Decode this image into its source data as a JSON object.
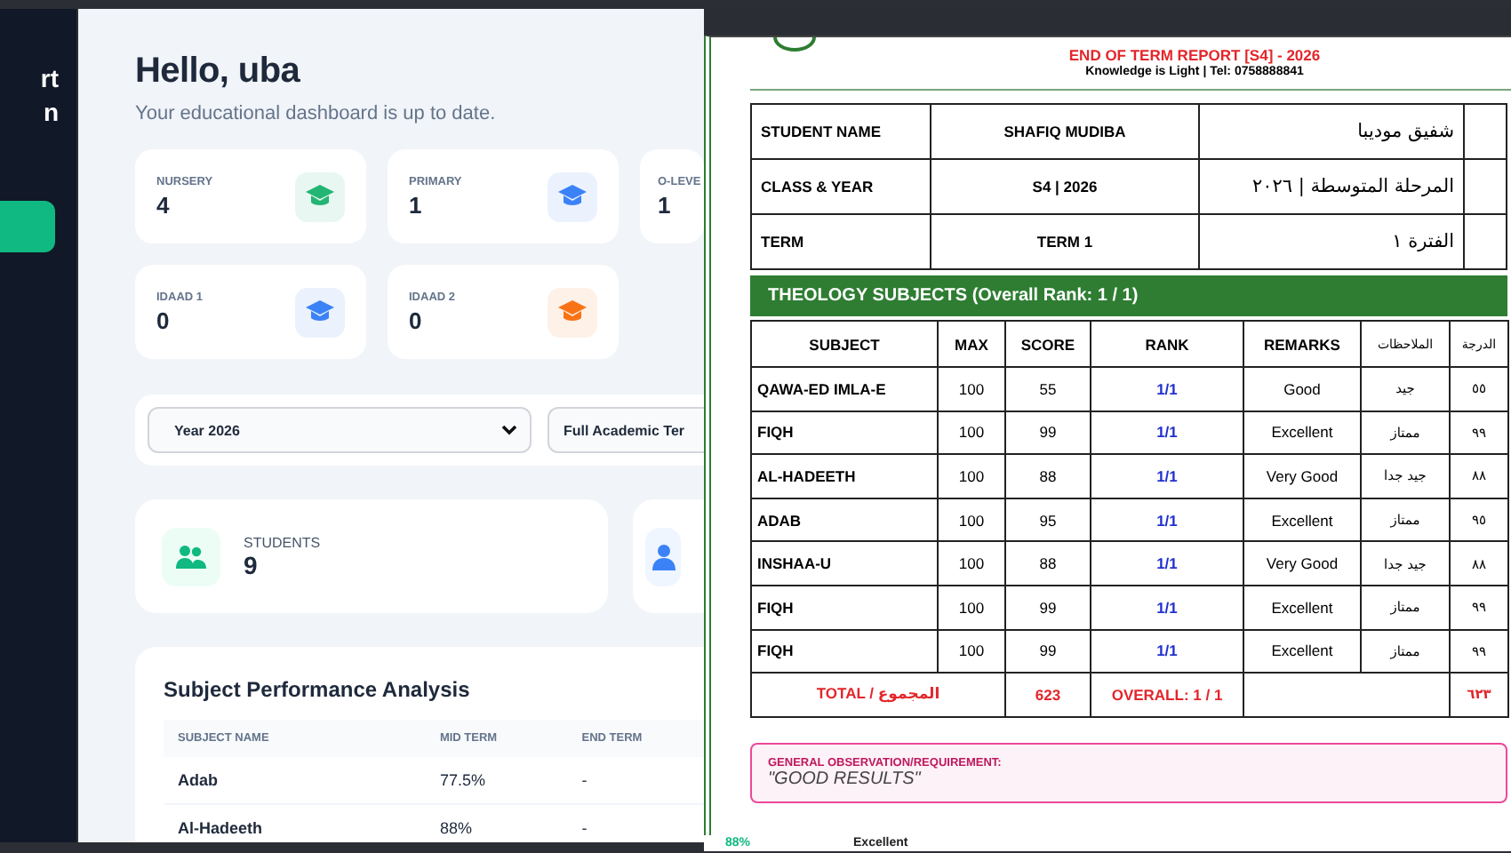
{
  "sidebar": {
    "brand_lines": [
      "rt",
      "n"
    ]
  },
  "greeting": "Hello, uba",
  "subtitle": "Your educational dashboard is up to date.",
  "level_cards": [
    {
      "label": "NURSERY",
      "count": "4",
      "color": "#22b573"
    },
    {
      "label": "PRIMARY",
      "count": "1",
      "color": "#3b82f6"
    },
    {
      "label": "O-LEVE",
      "count": "1"
    },
    {
      "label": "IDAAD 1",
      "count": "0",
      "color": "#3b82f6"
    },
    {
      "label": "IDAAD 2",
      "count": "0",
      "color": "#f97316"
    }
  ],
  "filters": [
    {
      "value": "Year 2026"
    },
    {
      "value": "Full Academic Ter"
    }
  ],
  "stat_cards": [
    {
      "kind": "students",
      "label": "STUDENTS",
      "value": "9"
    },
    {
      "kind": "person"
    }
  ],
  "subject_performance": {
    "title": "Subject Performance Analysis",
    "columns": [
      "SUBJECT NAME",
      "MID TERM",
      "END TERM"
    ],
    "rows": [
      [
        "Adab",
        "77.5%",
        "-"
      ],
      [
        "Al-Hadeeth",
        "88%",
        "-"
      ]
    ]
  },
  "background_peek": [
    "88%",
    "Excellent"
  ],
  "report": {
    "title": "END OF TERM REPORT [S4] - 2026",
    "tagline": "Knowledge is Light | Tel: 0758888841",
    "info_rows": [
      {
        "label": "STUDENT NAME",
        "value": "SHAFIQ MUDIBA",
        "arabic": "شفيق موديبا"
      },
      {
        "label": "CLASS & YEAR",
        "value": "S4 | 2026",
        "arabic": "المرحلة المتوسطة | ٢٠٢٦"
      },
      {
        "label": "TERM",
        "value": "TERM 1",
        "arabic": "الفترة ١"
      }
    ],
    "section_title": "THEOLOGY SUBJECTS (Overall Rank: 1 / 1)",
    "columns": [
      "SUBJECT",
      "MAX",
      "SCORE",
      "RANK",
      "REMARKS",
      "الملاحظات",
      "الدرجة"
    ],
    "rows": [
      [
        "QAWA-ED IMLA-E",
        "100",
        "55",
        "1/1",
        "Good",
        "جيد",
        "٥٥"
      ],
      [
        "FIQH",
        "100",
        "99",
        "1/1",
        "Excellent",
        "ممتاز",
        "٩٩"
      ],
      [
        "AL-HADEETH",
        "100",
        "88",
        "1/1",
        "Very Good",
        "جيد جدا",
        "٨٨"
      ],
      [
        "ADAB",
        "100",
        "95",
        "1/1",
        "Excellent",
        "ممتاز",
        "٩٥"
      ],
      [
        "INSHAA-U",
        "100",
        "88",
        "1/1",
        "Very Good",
        "جيد جدا",
        "٨٨"
      ],
      [
        "FIQH",
        "100",
        "99",
        "1/1",
        "Excellent",
        "ممتاز",
        "٩٩"
      ],
      [
        "FIQH",
        "100",
        "99",
        "1/1",
        "Excellent",
        "ممتاز",
        "٩٩"
      ]
    ],
    "total": {
      "label": "TOTAL / المجموع",
      "score": "623",
      "overall": "OVERALL: 1 / 1",
      "arabic_total": "٦٢٣"
    },
    "observation": {
      "label": "GENERAL OBSERVATION/REQUIREMENT:",
      "text": "\"GOOD RESULTS\""
    }
  }
}
